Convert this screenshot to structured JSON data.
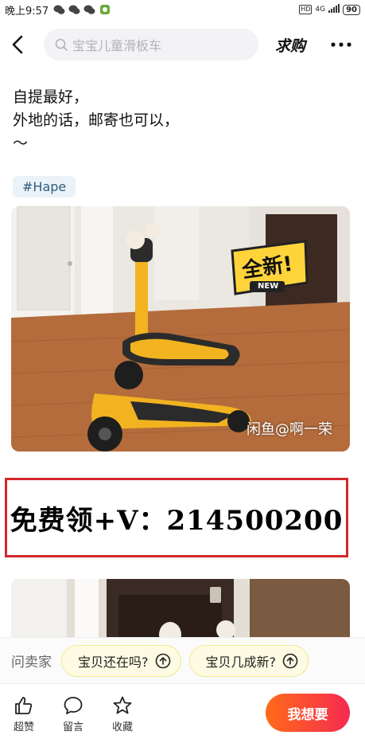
{
  "status_bar": {
    "time": "晚上9:57",
    "hd": "HD",
    "network": "4G",
    "battery": "90"
  },
  "nav": {
    "search_placeholder": "宝宝儿童滑板车",
    "qiugou_label": "求购"
  },
  "post": {
    "description": "自提最好，\n外地的话，邮寄也可以，\n～",
    "tag": "#Hape"
  },
  "photo1": {
    "sticker_text": "全新!",
    "sticker_sub": "NEW",
    "watermark": "闲鱼@啊一荣"
  },
  "promo": {
    "text": "免费领+V：214500200"
  },
  "ask": {
    "label": "问卖家",
    "questions": [
      "宝贝还在吗?",
      "宝贝几成新?"
    ]
  },
  "bottom_bar": {
    "like_label": "超赞",
    "comment_label": "留言",
    "favorite_label": "收藏",
    "want_label": "我想要"
  },
  "colors": {
    "accent_gradient_start": "#ff6b1a",
    "accent_gradient_end": "#f52a50",
    "promo_border": "#d4272b",
    "chip_bg": "#fdfbe4",
    "tag_bg": "#ebf3f9"
  }
}
